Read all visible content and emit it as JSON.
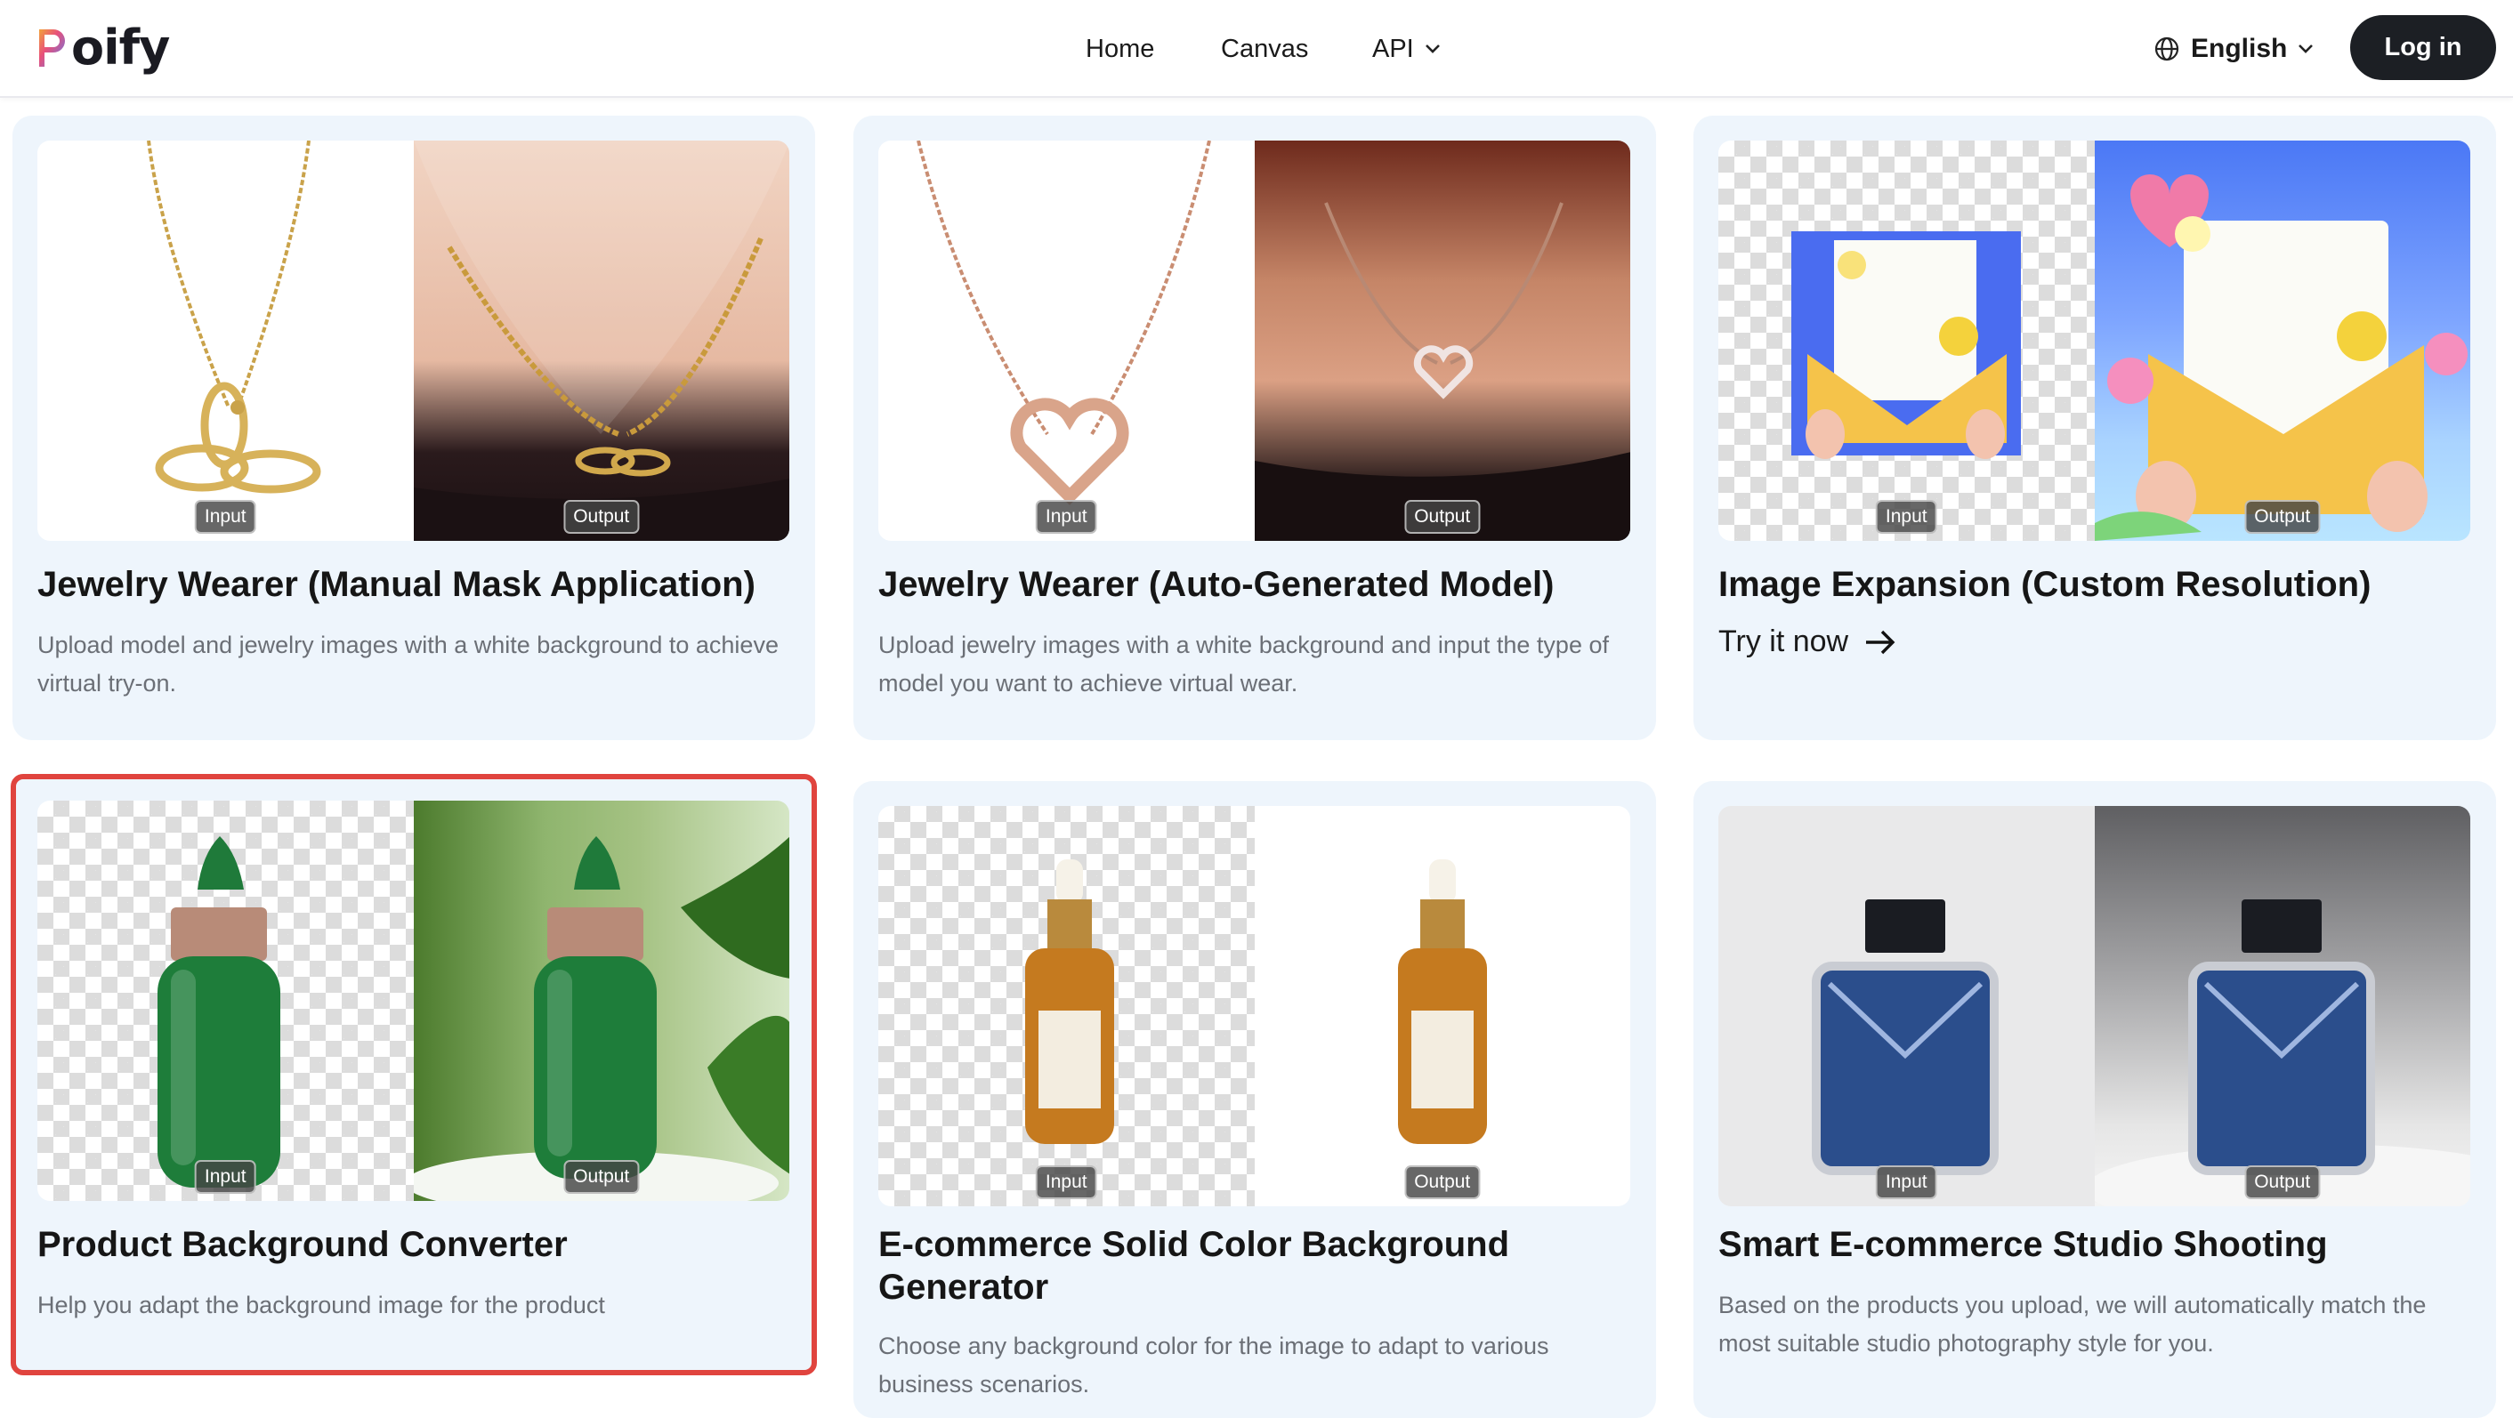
{
  "header": {
    "logo": "oify",
    "nav": {
      "home": "Home",
      "canvas": "Canvas",
      "api": "API"
    },
    "language": "English",
    "login": "Log in"
  },
  "tags": {
    "input": "Input",
    "output": "Output"
  },
  "cards": [
    {
      "title": "Jewelry Wearer (Manual Mask Application)",
      "desc": "Upload model and jewelry images with a white background to achieve virtual try-on."
    },
    {
      "title": "Jewelry Wearer (Auto-Generated Model)",
      "desc": "Upload jewelry images with a white background and input the type of model you want to achieve virtual wear."
    },
    {
      "title": "Image Expansion (Custom Resolution)",
      "cta": "Try it now"
    },
    {
      "title": "Product Background Converter",
      "desc": "Help you adapt the background image for the product",
      "selected": true
    },
    {
      "title": "E-commerce Solid Color Background Generator",
      "desc": "Choose any background color for the image to adapt to various business scenarios."
    },
    {
      "title": "Smart E-commerce Studio Shooting",
      "desc": "Based on the products you upload, we will automatically match the most suitable studio photography style for you."
    }
  ],
  "colors": {
    "selected_outline": "#e0443e",
    "card_bg": "#eef5fc",
    "login_bg": "#1c1f24"
  }
}
